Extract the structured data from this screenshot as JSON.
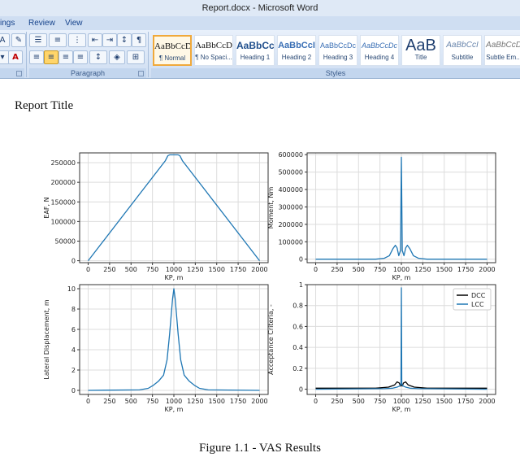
{
  "window": {
    "title": "Report.docx - Microsoft Word"
  },
  "tabs": [
    "ings",
    "Review",
    "View"
  ],
  "ribbon": {
    "paragraph_label": "Paragraph",
    "styles_label": "Styles",
    "styles": [
      {
        "sample": "AaBbCcD",
        "name": "¶ Normal",
        "selected": true
      },
      {
        "sample": "AaBbCcD",
        "name": "¶ No Spaci..."
      },
      {
        "sample": "AaBbCc",
        "name": "Heading 1"
      },
      {
        "sample": "AaBbCcI",
        "name": "Heading 2"
      },
      {
        "sample": "AaBbCcDc",
        "name": "Heading 3"
      },
      {
        "sample": "AaBbCcDc",
        "name": "Heading 4"
      },
      {
        "sample": "AaB",
        "name": "Title"
      },
      {
        "sample": "AaBbCcI",
        "name": "Subtitle"
      },
      {
        "sample": "AaBbCcD",
        "name": "Subtle Em..."
      }
    ]
  },
  "document": {
    "title": "Report Title",
    "caption": "Figure 1.1 - VAS Results"
  },
  "chart_data": [
    {
      "type": "line",
      "xlabel": "KP, m",
      "ylabel": "EAF, N",
      "xlim": [
        -100,
        2100
      ],
      "ylim": [
        -5000,
        275000
      ],
      "xticks": [
        0,
        250,
        500,
        750,
        1000,
        1250,
        1500,
        1750,
        2000
      ],
      "yticks": [
        0,
        50000,
        100000,
        150000,
        200000,
        250000
      ],
      "grid": true,
      "series": [
        {
          "color": "#1f77b4",
          "x": [
            0,
            900,
            930,
            950,
            1050,
            1070,
            1100,
            2000
          ],
          "y": [
            0,
            255000,
            268000,
            270000,
            270000,
            268000,
            255000,
            0
          ]
        }
      ]
    },
    {
      "type": "line",
      "xlabel": "KP, m",
      "ylabel": "Moment, Nm",
      "xlim": [
        -100,
        2100
      ],
      "ylim": [
        -20000,
        610000
      ],
      "xticks": [
        0,
        250,
        500,
        750,
        1000,
        1250,
        1500,
        1750,
        2000
      ],
      "yticks": [
        0,
        100000,
        200000,
        300000,
        400000,
        500000,
        600000
      ],
      "grid": true,
      "series": [
        {
          "color": "#1f77b4",
          "x": [
            0,
            700,
            800,
            860,
            900,
            930,
            950,
            970,
            990,
            1000,
            1010,
            1030,
            1050,
            1070,
            1100,
            1140,
            1200,
            1300,
            2000
          ],
          "y": [
            0,
            0,
            5000,
            20000,
            60000,
            80000,
            65000,
            20000,
            50000,
            585000,
            50000,
            20000,
            65000,
            80000,
            60000,
            20000,
            5000,
            0,
            0
          ]
        }
      ]
    },
    {
      "type": "line",
      "xlabel": "KP, m",
      "ylabel": "Lateral Displacement, m",
      "xlim": [
        -100,
        2100
      ],
      "ylim": [
        -0.4,
        10.4
      ],
      "xticks": [
        0,
        250,
        500,
        750,
        1000,
        1250,
        1500,
        1750,
        2000
      ],
      "yticks": [
        0,
        2,
        4,
        6,
        8,
        10
      ],
      "grid": true,
      "series": [
        {
          "color": "#1f77b4",
          "x": [
            0,
            600,
            700,
            760,
            820,
            880,
            920,
            950,
            970,
            985,
            1000,
            1015,
            1030,
            1050,
            1080,
            1120,
            1180,
            1240,
            1300,
            1400,
            2000
          ],
          "y": [
            0,
            0.05,
            0.2,
            0.5,
            0.9,
            1.5,
            3.0,
            5.5,
            7.5,
            9.0,
            10.0,
            9.0,
            7.5,
            5.5,
            3.0,
            1.5,
            0.9,
            0.5,
            0.2,
            0.05,
            0
          ]
        }
      ]
    },
    {
      "type": "line",
      "xlabel": "KP, m",
      "ylabel": "Acceptance Criteria, -",
      "xlim": [
        -100,
        2100
      ],
      "ylim": [
        -0.05,
        1.0
      ],
      "xticks": [
        0,
        250,
        500,
        750,
        1000,
        1250,
        1500,
        1750,
        2000
      ],
      "yticks": [
        0.0,
        0.2,
        0.4,
        0.6,
        0.8,
        1.0
      ],
      "grid": true,
      "legend": "top-right",
      "series": [
        {
          "name": "DCC",
          "color": "#000000",
          "x": [
            0,
            700,
            850,
            920,
            950,
            975,
            990,
            1000,
            1010,
            1025,
            1050,
            1080,
            1150,
            1300,
            2000
          ],
          "y": [
            0.01,
            0.01,
            0.02,
            0.04,
            0.07,
            0.06,
            0.03,
            0.05,
            0.03,
            0.06,
            0.07,
            0.04,
            0.02,
            0.01,
            0.01
          ]
        },
        {
          "name": "LCC",
          "color": "#1f77b4",
          "x": [
            0,
            800,
            900,
            950,
            980,
            995,
            1000,
            1005,
            1020,
            1050,
            1100,
            1200,
            2000
          ],
          "y": [
            0.0,
            0.005,
            0.01,
            0.02,
            0.03,
            0.05,
            0.97,
            0.05,
            0.03,
            0.02,
            0.01,
            0.005,
            0.0
          ]
        }
      ]
    }
  ]
}
